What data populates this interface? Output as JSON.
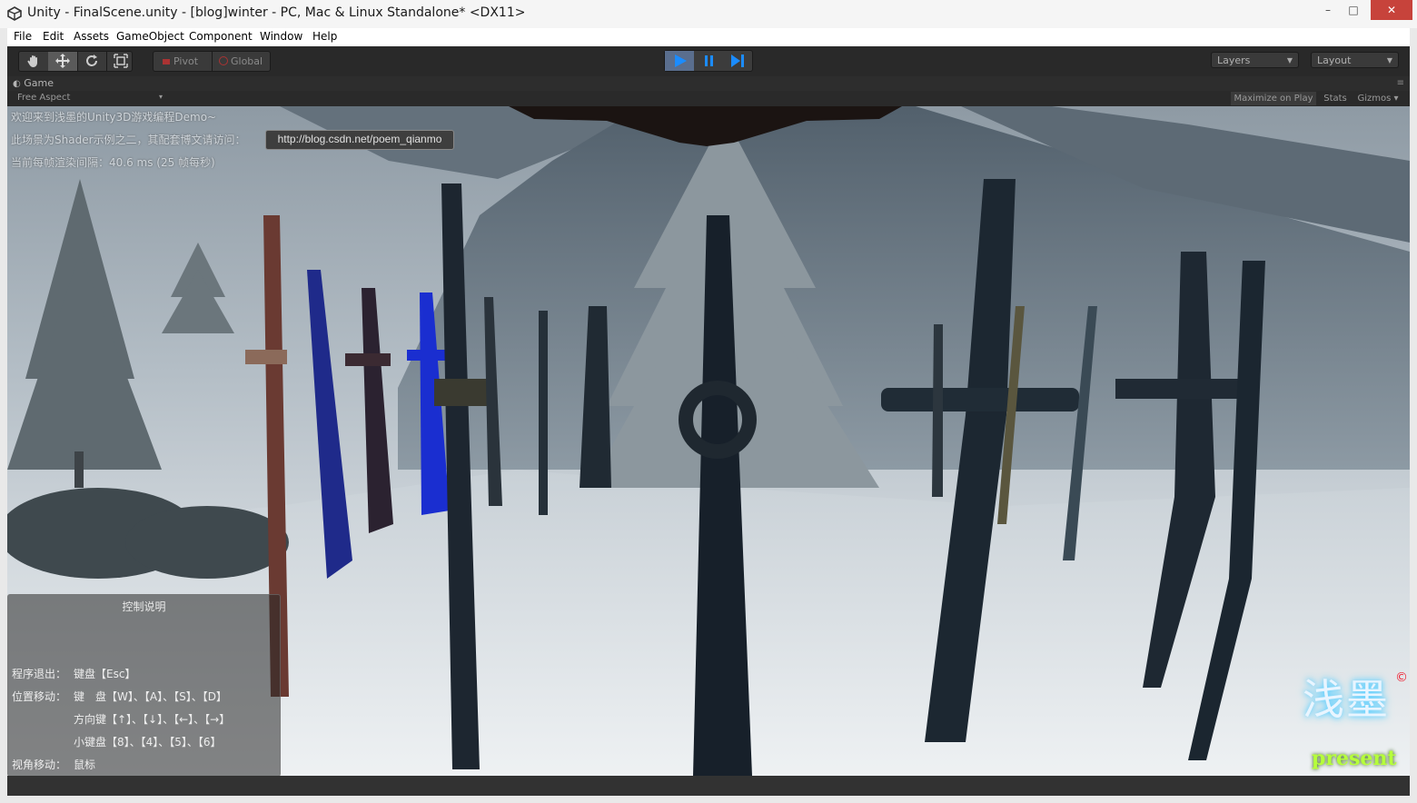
{
  "window": {
    "title": "Unity - FinalScene.unity - [blog]winter - PC, Mac & Linux Standalone* <DX11>",
    "controls": {
      "minimize": "–",
      "maximize": "□",
      "close": "✕"
    }
  },
  "menu": [
    "File",
    "Edit",
    "Assets",
    "GameObject",
    "Component",
    "Window",
    "Help"
  ],
  "toolbar": {
    "transform_tools": [
      "hand-icon",
      "move-icon",
      "rotate-icon",
      "scale-icon"
    ],
    "pivot_label": "Pivot",
    "global_label": "Global",
    "play_controls": [
      "play-icon",
      "pause-icon",
      "step-icon"
    ],
    "layers_label": "Layers",
    "layout_label": "Layout"
  },
  "game_panel": {
    "tab_label": "Game",
    "aspect_label": "Free Aspect",
    "maximize_label": "Maximize on Play",
    "stats_label": "Stats",
    "gizmos_label": "Gizmos"
  },
  "overlay": {
    "welcome": "欢迎来到浅墨的Unity3D游戏编程Demo~",
    "scene_info": "此场景为Shader示例之二，其配套博文请访问：",
    "url": "http://blog.csdn.net/poem_qianmo",
    "frame_time": "当前每帧渲染间隔：40.6 ms (25 帧每秒)"
  },
  "help": {
    "title": "控制说明",
    "exit_label": "程序退出：",
    "exit_value": "键盘【Esc】",
    "move_label": "位置移动：",
    "move_keys": "键　盘【W】、【A】、【S】、【D】",
    "move_arrows": "方向键【↑】、【↓】、【←】、【→】",
    "move_numpad": "小键盘【8】、【4】、【5】、【6】",
    "view_label": "视角移动：",
    "view_value": "鼠标"
  },
  "logo": {
    "chars": "浅墨",
    "present": "present",
    "copyright": "©"
  },
  "colors": {
    "play_active": "#5a6e8e",
    "close": "#c7433b",
    "logo_green": "#b6ff3a",
    "logo_blue": "#5fd0ff"
  }
}
